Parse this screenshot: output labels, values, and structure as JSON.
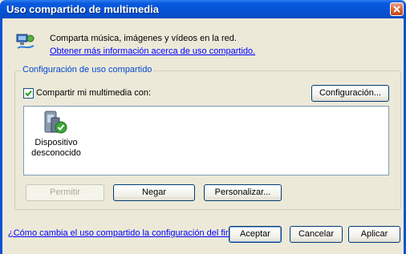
{
  "window": {
    "title": "Uso compartido de multimedia"
  },
  "info": {
    "description": "Comparta música, imágenes y vídeos en la red.",
    "link": "Obtener más información acerca de uso compartido."
  },
  "sharing": {
    "group_label": "Configuración de uso compartido",
    "checkbox_label": "Compartir mi multimedia con:",
    "checked": true,
    "settings_button": "Configuración...",
    "devices": [
      {
        "label": "Dispositivo desconocido",
        "icon": "media-device-icon"
      }
    ],
    "allow_button": "Permitir",
    "deny_button": "Negar",
    "customize_button": "Personalizar..."
  },
  "footer": {
    "firewall_link": "¿Cómo cambia el uso compartido la configuración del firewall?",
    "ok_button": "Aceptar",
    "cancel_button": "Cancelar",
    "apply_button": "Aplicar"
  },
  "colors": {
    "titlebar": "#0a5ae0",
    "link": "#0000ff",
    "group_label": "#0046d5",
    "background": "#ece9d8"
  }
}
